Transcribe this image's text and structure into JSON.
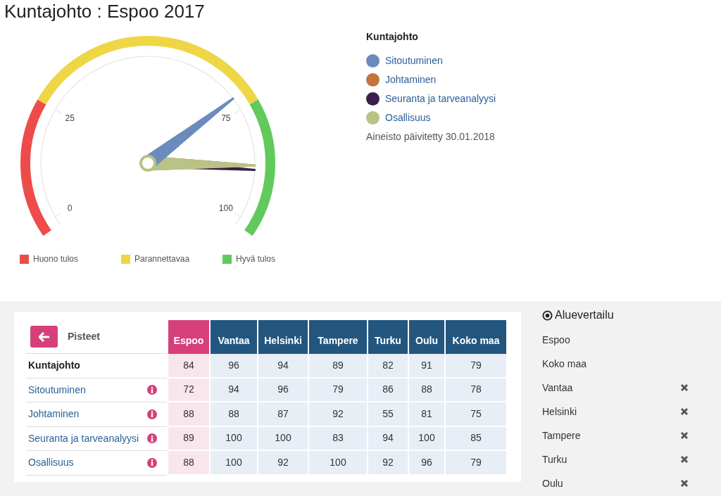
{
  "title": "Kuntajohto : Espoo 2017",
  "gauge": {
    "ticks": [
      "25",
      "75",
      "0",
      "100"
    ],
    "bands": [
      {
        "label": "Huono tulos",
        "color": "#ee4b4b"
      },
      {
        "label": "Parannettavaa",
        "color": "#eed646"
      },
      {
        "label": "Hyvä tulos",
        "color": "#62c95c"
      }
    ]
  },
  "legend": {
    "title": "Kuntajohto",
    "items": [
      {
        "label": "Sitoutuminen",
        "color": "#6b8bbd"
      },
      {
        "label": "Johtaminen",
        "color": "#c5733a"
      },
      {
        "label": "Seuranta ja tarveanalyysi",
        "color": "#3a1f4a"
      },
      {
        "label": "Osallisuus",
        "color": "#b9c287"
      }
    ],
    "updated": "Aineisto päivitetty 30.01.2018"
  },
  "table": {
    "back_label": "Pisteet",
    "columns": [
      {
        "label": "Espoo",
        "selected": true
      },
      {
        "label": "Vantaa",
        "selected": false
      },
      {
        "label": "Helsinki",
        "selected": false
      },
      {
        "label": "Tampere",
        "selected": false
      },
      {
        "label": "Turku",
        "selected": false
      },
      {
        "label": "Oulu",
        "selected": false
      },
      {
        "label": "Koko maa",
        "selected": false
      }
    ],
    "rows": [
      {
        "kind": "total",
        "label": "Kuntajohto",
        "values": [
          "84",
          "96",
          "94",
          "89",
          "82",
          "91",
          "79"
        ]
      },
      {
        "kind": "measure",
        "label": "Sitoutuminen",
        "values": [
          "72",
          "94",
          "96",
          "79",
          "86",
          "88",
          "78"
        ]
      },
      {
        "kind": "measure",
        "label": "Johtaminen",
        "values": [
          "88",
          "88",
          "87",
          "92",
          "55",
          "81",
          "75"
        ]
      },
      {
        "kind": "measure",
        "label": "Seuranta ja tarveanalyysi",
        "values": [
          "89",
          "100",
          "100",
          "83",
          "94",
          "100",
          "85"
        ]
      },
      {
        "kind": "measure",
        "label": "Osallisuus",
        "values": [
          "88",
          "100",
          "92",
          "100",
          "92",
          "96",
          "79"
        ]
      }
    ]
  },
  "comparison": {
    "title": "Aluevertailu",
    "items": [
      {
        "label": "Espoo",
        "removable": false
      },
      {
        "label": "Koko maa",
        "removable": false
      },
      {
        "label": "Vantaa",
        "removable": true
      },
      {
        "label": "Helsinki",
        "removable": true
      },
      {
        "label": "Tampere",
        "removable": true
      },
      {
        "label": "Turku",
        "removable": true
      },
      {
        "label": "Oulu",
        "removable": true
      }
    ]
  }
}
